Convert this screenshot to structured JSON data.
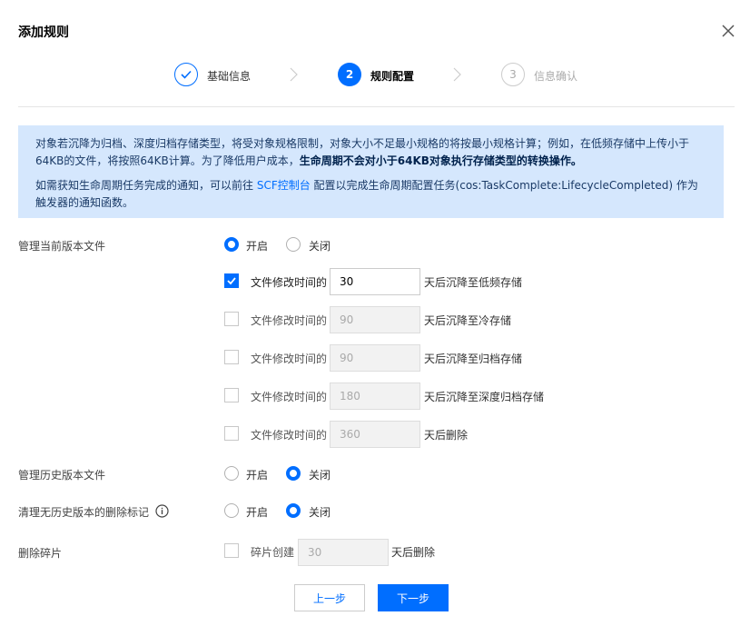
{
  "dialog": {
    "title": "添加规则"
  },
  "steps": [
    {
      "number": "",
      "label": "基础信息",
      "state": "done"
    },
    {
      "number": "2",
      "label": "规则配置",
      "state": "active"
    },
    {
      "number": "3",
      "label": "信息确认",
      "state": "pending"
    }
  ],
  "notice": {
    "p1_part1": "对象若沉降为归档、深度归档存储类型，将受对象规格限制，对象大小不足最小规格的将按最小规格计算；例如，在低频存储中上传小于64KB的文件，将按照64KB计算。为了降低用户成本，",
    "p1_bold": "生命周期不会对小于64KB对象执行存储类型的转换操作。",
    "p2_part1": "如需获知生命周期任务完成的通知，可以前往 ",
    "p2_link": "SCF控制台",
    "p2_part2": " 配置以完成生命周期配置任务(cos:TaskComplete:LifecycleCompleted) 作为触发器的通知函数。"
  },
  "current_version": {
    "label": "管理当前版本文件",
    "on_label": "开启",
    "off_label": "关闭",
    "selected": "on",
    "rules": [
      {
        "checked": true,
        "prefix": "文件修改时间的",
        "value": "30",
        "suffix": "天后沉降至低频存储"
      },
      {
        "checked": false,
        "prefix": "文件修改时间的",
        "value": "90",
        "suffix": "天后沉降至冷存储"
      },
      {
        "checked": false,
        "prefix": "文件修改时间的",
        "value": "90",
        "suffix": "天后沉降至归档存储"
      },
      {
        "checked": false,
        "prefix": "文件修改时间的",
        "value": "180",
        "suffix": "天后沉降至深度归档存储"
      },
      {
        "checked": false,
        "prefix": "文件修改时间的",
        "value": "360",
        "suffix": "天后删除"
      }
    ]
  },
  "history_version": {
    "label": "管理历史版本文件",
    "on_label": "开启",
    "off_label": "关闭",
    "selected": "off"
  },
  "delete_marker": {
    "label": "清理无历史版本的删除标记",
    "on_label": "开启",
    "off_label": "关闭",
    "selected": "off"
  },
  "fragments": {
    "label": "删除碎片",
    "checked": false,
    "prefix": "碎片创建",
    "value": "30",
    "suffix": "天后删除"
  },
  "buttons": {
    "prev": "上一步",
    "next": "下一步"
  },
  "colors": {
    "primary": "#006eff",
    "notice_bg": "#d5e7fd"
  }
}
